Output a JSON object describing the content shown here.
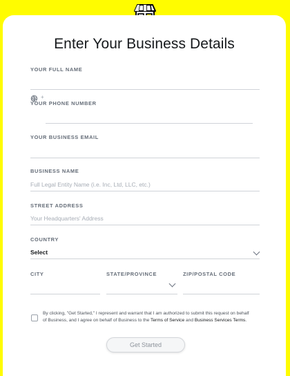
{
  "header": {
    "icon": "storefront-icon"
  },
  "form": {
    "title": "Enter Your Business Details",
    "full_name": {
      "label": "YOUR FULL NAME",
      "value": ""
    },
    "phone": {
      "label": "YOUR PHONE NUMBER",
      "prefix": "+",
      "value": ""
    },
    "email": {
      "label": "YOUR BUSINESS EMAIL",
      "value": ""
    },
    "business_name": {
      "label": "BUSINESS NAME",
      "placeholder": "Full Legal Entity Name (i.e. Inc, Ltd, LLC, etc.)"
    },
    "street": {
      "label": "STREET ADDRESS",
      "placeholder": "Your Headquarters' Address"
    },
    "country": {
      "label": "COUNTRY",
      "value": "Select"
    },
    "city": {
      "label": "CITY",
      "value": ""
    },
    "state": {
      "label": "STATE/PROVINCE",
      "value": ""
    },
    "zip": {
      "label": "ZIP/POSTAL CODE",
      "value": ""
    },
    "terms": {
      "text1": "By clicking, \"Get Started,\" I represent and warrant that I am authorized to submit this request on behalf of Business, and I agree on behalf of Business to the ",
      "terms_link": "Terms of Service",
      "and": " and ",
      "bst_link": "Business Services Terms",
      "end": "."
    },
    "submit_label": "Get Started"
  },
  "colors": {
    "background": "#FFFC00",
    "card": "#FFFFFF"
  }
}
